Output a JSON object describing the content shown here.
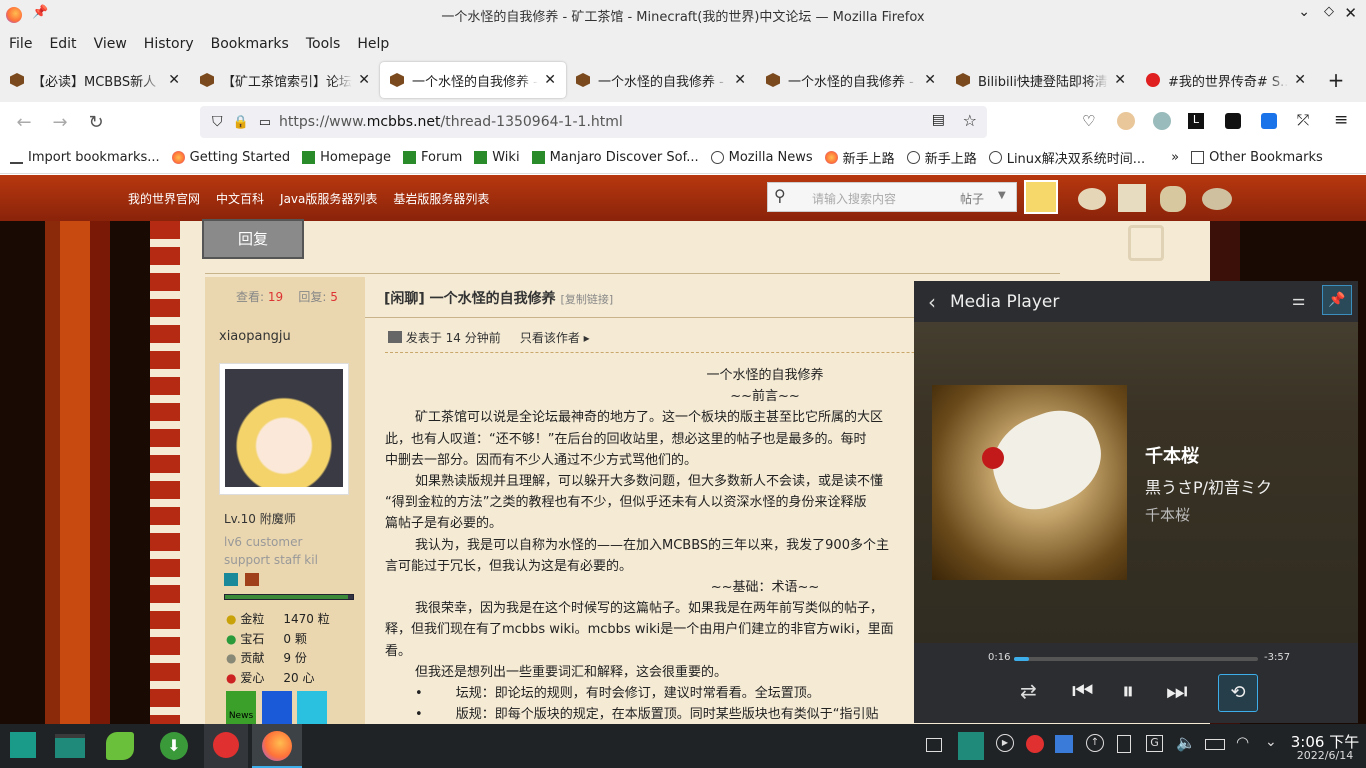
{
  "window": {
    "title": "一个水怪的自我修养 - 矿工茶馆 - Minecraft(我的世界)中文论坛 — Mozilla Firefox"
  },
  "menu": [
    "File",
    "Edit",
    "View",
    "History",
    "Bookmarks",
    "Tools",
    "Help"
  ],
  "tabs": [
    {
      "label": "【必读】MCBBS新人"
    },
    {
      "label": "【矿工茶馆索引】论坛"
    },
    {
      "label": "一个水怪的自我修养 - "
    },
    {
      "label": "一个水怪的自我修养 - "
    },
    {
      "label": "一个水怪的自我修养 - "
    },
    {
      "label": "Bilibili快捷登陆即将清"
    },
    {
      "label": "#我的世界传奇# S..."
    }
  ],
  "url": {
    "prefix": "https://www.",
    "domain": "mcbbs.net",
    "path": "/thread-1350964-1-1.html"
  },
  "bookmarks": [
    "Import bookmarks...",
    "Getting Started",
    "Homepage",
    "Forum",
    "Wiki",
    "Manjaro Discover Sof...",
    "Mozilla News",
    "新手上路",
    "新手上路",
    "Linux解决双系统时间...",
    "Other Bookmarks"
  ],
  "site": {
    "nav": [
      "我的世界官网",
      "中文百科",
      "Java版服务器列表",
      "基岩版服务器列表"
    ],
    "search_placeholder": "请输入搜索内容",
    "search_scope": "帖子",
    "reply_button": "回复",
    "views_label": "查看:",
    "views": "19",
    "replies_label": "回复:",
    "replies": "5",
    "author": "xiaopangju",
    "level": "Lv.10 附魔师",
    "custom_title": "lv6 customer support staff kil",
    "stats": [
      {
        "label": "金粒",
        "value": "1470 粒"
      },
      {
        "label": "宝石",
        "value": "0 颗"
      },
      {
        "label": "贡献",
        "value": "9 份"
      },
      {
        "label": "爱心",
        "value": "20 心"
      }
    ],
    "medal_label": "News",
    "post_tag": "[闲聊]",
    "post_title": "一个水怪的自我修养",
    "copy_link": "[复制链接]",
    "posted": "发表于 14 分钟前",
    "only_author": "只看该作者",
    "body": [
      "一个水怪的自我修养",
      "~~前言~~",
      "矿工茶馆可以说是全论坛最神奇的地方了。这一个板块的版主甚至比它所属的大区",
      "此，也有人叹道：“还不够！”在后台的回收站里，想必这里的帖子也是最多的。每时",
      "中删去一部分。因而有不少人通过不少方式骂他们的。",
      "如果熟读版规并且理解，可以躲开大多数问题，但大多数新人不会读，或是读不懂",
      "“得到金粒的方法”之类的教程也有不少，但似乎还未有人以资深水怪的身份来诠释版",
      "篇帖子是有必要的。",
      "我认为，我是可以自称为水怪的——在加入MCBBS的三年以来，我发了900多个主",
      "言可能过于冗长，但我认为这是有必要的。",
      "~~基础：术语~~",
      "我很荣幸，因为我是在这个时候写的这篇帖子。如果我是在两年前写类似的帖子，",
      "释，但我们现在有了mcbbs wiki。mcbbs wiki是一个由用户们建立的非官方wiki，里面",
      "看。",
      "但我还是想列出一些重要词汇和解释，这会很重要的。",
      "坛规：即论坛的规则，有时会修订，建议时常看看。全坛置顶。",
      "版规：即每个版块的规定，在本版置顶。同时某些版块也有类似于“指引贴"
    ]
  },
  "media_player": {
    "title": "Media Player",
    "track": "千本桜",
    "artist": "黒うさP/初音ミク",
    "album": "千本桜",
    "elapsed": "0:16",
    "remaining": "-3:57",
    "progress": 0.063
  },
  "clock": {
    "time": "3:06 下午",
    "date": "2022/6/14"
  }
}
